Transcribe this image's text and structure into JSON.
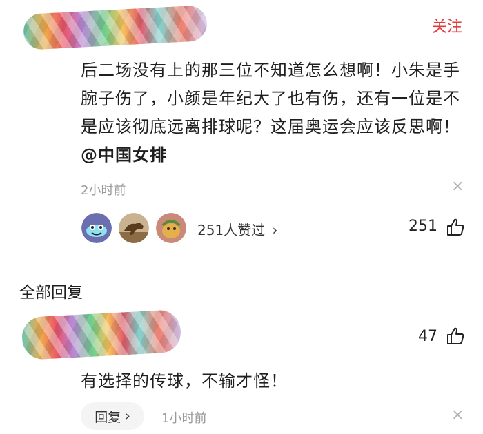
{
  "comment": {
    "follow_label": "关注",
    "text": "后二场没有上的那三位不知道怎么想啊！小朱是手腕子伤了，小颜是年纪大了也有伤，还有一位是不是应该彻底远离排球呢？这届奥运会应该反思啊！",
    "mention": "@中国女排",
    "time": "2小时前",
    "close_icon": "×",
    "likers_label": "251人赞过",
    "likers_chevron": "›",
    "like_count": "251"
  },
  "replies_section": {
    "title": "全部回复"
  },
  "reply": {
    "text": "有选择的传球，不输才怪！",
    "like_count": "47",
    "reply_button_label": "回复",
    "reply_chevron": "›",
    "time": "1小时前",
    "close_icon": "×"
  },
  "colors": {
    "follow": "#e23b3b",
    "meta": "#9a9a9a"
  }
}
